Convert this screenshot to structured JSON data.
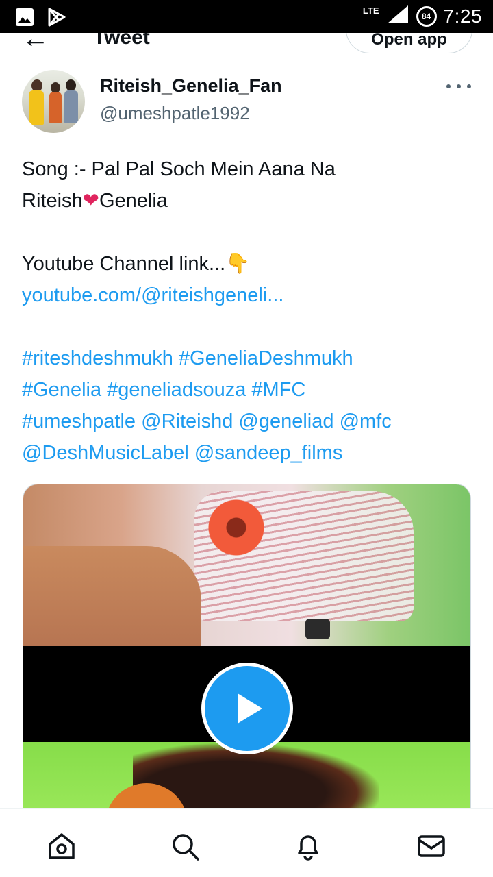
{
  "status_bar": {
    "time": "7:25",
    "network": "LTE",
    "battery": "84",
    "icons": [
      "image-icon",
      "play-store-icon",
      "signal-icon",
      "battery-icon"
    ]
  },
  "header": {
    "title": "Tweet",
    "open_app_label": "Open app",
    "back_icon": "back-arrow-icon"
  },
  "author": {
    "display_name": "Riteish_Genelia_Fan",
    "handle": "@umeshpatle1992"
  },
  "tweet": {
    "line1": "Song :- Pal Pal Soch Mein Aana Na",
    "line2_a": "Riteish",
    "line2_heart": "❤",
    "line2_b": "Genelia",
    "line3_text": "Youtube Channel link...",
    "line3_emoji": "👇",
    "link": "youtube.com/@riteishgeneli...",
    "tags": [
      [
        "#riteshdeshmukh",
        "#GeneliaDeshmukh"
      ],
      [
        "#Genelia",
        "#geneliadsouza",
        "#MFC"
      ],
      [
        "#umeshpatle",
        "@Riteishd",
        "@geneliad",
        "@mfc"
      ],
      [
        "@DeshMusicLabel",
        "@sandeep_films"
      ]
    ]
  },
  "media": {
    "type": "video",
    "play_icon": "play-icon"
  },
  "bottom_nav": {
    "items": [
      "home-icon",
      "search-icon",
      "notifications-icon",
      "messages-icon"
    ]
  },
  "colors": {
    "accent": "#1d9bf0",
    "text": "#0f1419",
    "secondary": "#536471",
    "heart": "#e0245e"
  }
}
